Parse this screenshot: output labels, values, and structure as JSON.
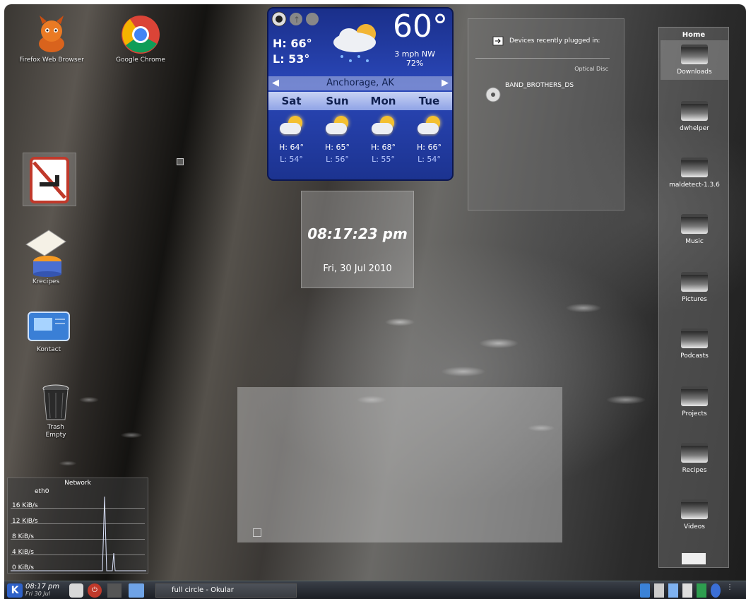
{
  "desktop_icons": [
    {
      "id": "firefox",
      "label": "Firefox Web Browser",
      "icon": "firefox-icon"
    },
    {
      "id": "chrome",
      "label": "Google Chrome",
      "icon": "chrome-icon"
    },
    {
      "id": "blocked",
      "label": "",
      "icon": "no-phone-icon"
    },
    {
      "id": "krecipes",
      "label": "Krecipes",
      "icon": "krecipes-icon"
    },
    {
      "id": "kontact",
      "label": "Kontact",
      "icon": "kontact-icon"
    },
    {
      "id": "trash",
      "label": "Trash\nEmpty",
      "icon": "trash-icon"
    }
  ],
  "weather": {
    "high": "H: 66°",
    "low": "L: 53°",
    "temp": "60°",
    "wind": "3 mph NW",
    "humidity": "72%",
    "city": "Anchorage, AK",
    "days": [
      "Sat",
      "Sun",
      "Mon",
      "Tue"
    ],
    "forecast": [
      {
        "hi": "H: 64°",
        "lo": "L: 54°"
      },
      {
        "hi": "H: 65°",
        "lo": "L: 56°"
      },
      {
        "hi": "H: 68°",
        "lo": "L: 55°"
      },
      {
        "hi": "H: 66°",
        "lo": "L: 54°"
      }
    ]
  },
  "clock": {
    "time": "08:17:23 pm",
    "date": "Fri, 30 Jul 2010"
  },
  "devices": {
    "header": "Devices recently plugged in:",
    "optical": "Optical Disc",
    "item": "BAND_BROTHERS_DS"
  },
  "home": {
    "title": "Home",
    "folders": [
      "Downloads",
      "dwhelper",
      "maldetect-1.3.6",
      "Music",
      "Pictures",
      "Podcasts",
      "Projects",
      "Recipes",
      "Videos"
    ]
  },
  "network": {
    "title": "Network",
    "iface": "eth0",
    "y_labels": [
      "16 KiB/s",
      "12 KiB/s",
      "8 KiB/s",
      "4 KiB/s",
      "0 KiB/s"
    ]
  },
  "taskbar": {
    "time": "08:17 pm",
    "date": "Fri 30 Jul",
    "task": "full circle - Okular"
  },
  "colors": {
    "weather_bg": "#2a47b8",
    "taskbar": "#1b1e24"
  }
}
